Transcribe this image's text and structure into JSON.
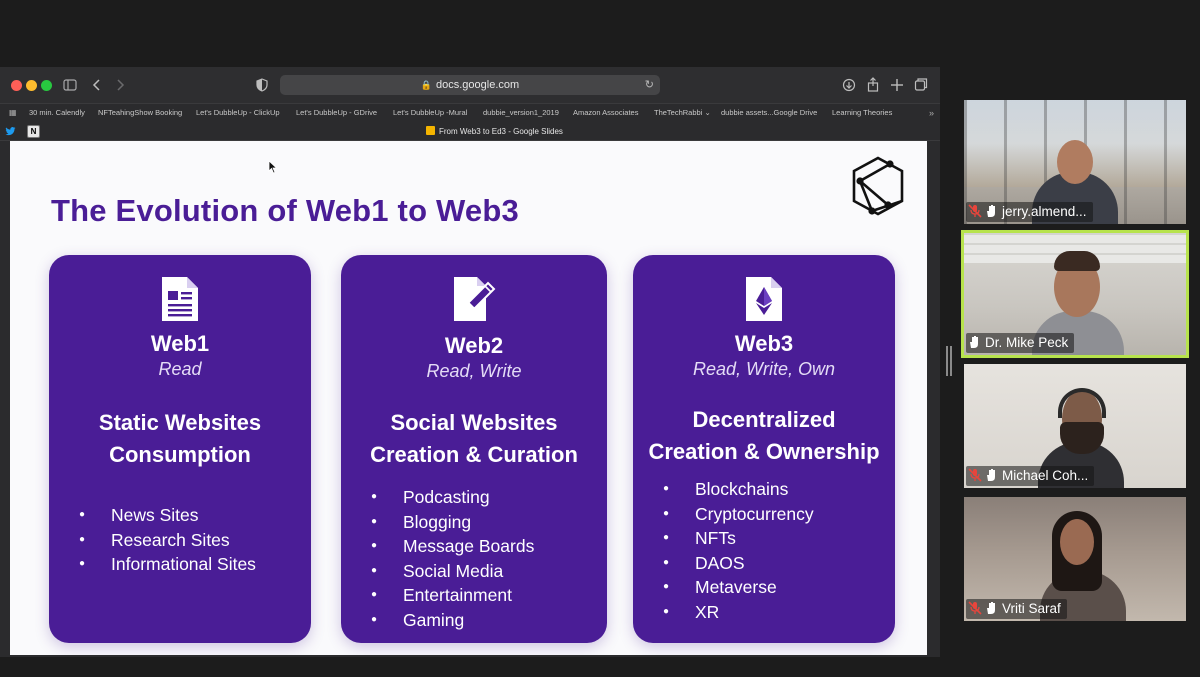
{
  "browser": {
    "url": "docs.google.com",
    "bookmarks": [
      "30 min. Calendly",
      "NFTeahingShow Booking",
      "Let's DubbleUp - ClickUp",
      "Let's DubbleUp - GDrive",
      "Let's DubbleUp -Mural",
      "dubbie_version1_2019",
      "Amazon Associates",
      "TheTechRabbi",
      "dubbie assets...Google Drive",
      "Learning Theories"
    ],
    "tab_title": "From Web3 to Ed3 - Google Slides",
    "icons": [
      "sidebar-icon",
      "back-icon",
      "forward-icon",
      "shield-icon",
      "reload-icon",
      "download-icon",
      "share-icon",
      "new-tab-icon",
      "tabs-overview-icon"
    ]
  },
  "slide": {
    "title": "The Evolution of Web1 to Web3",
    "cards": [
      {
        "name": "Web1",
        "sub": "Read",
        "heading_lines": [
          "Static Websites",
          "Consumption"
        ],
        "items": [
          "News Sites",
          "Research Sites",
          "Informational Sites"
        ],
        "icon": "document-icon"
      },
      {
        "name": "Web2",
        "sub": "Read, Write",
        "heading_lines": [
          "Social Websites",
          "Creation & Curation"
        ],
        "items": [
          "Podcasting",
          "Blogging",
          "Message Boards",
          "Social Media",
          "Entertainment",
          "Gaming"
        ],
        "icon": "edit-document-icon"
      },
      {
        "name": "Web3",
        "sub": "Read, Write, Own",
        "heading_lines": [
          "Decentralized",
          "Creation & Ownership"
        ],
        "items": [
          "Blockchains",
          "Cryptocurrency",
          "NFTs",
          "DAOS",
          "Metaverse",
          "XR"
        ],
        "icon": "ethereum-document-icon"
      }
    ],
    "accent_color": "#4a1d96"
  },
  "participants": [
    {
      "name": "jerry.almend...",
      "muted": true
    },
    {
      "name": "Dr. Mike Peck",
      "muted": false,
      "speaking": true
    },
    {
      "name": "Michael Coh...",
      "muted": true
    },
    {
      "name": "Vriti Saraf",
      "muted": true
    }
  ],
  "colors": {
    "speaking_border": "#b7e34d",
    "mic_off": "#e8453c"
  }
}
